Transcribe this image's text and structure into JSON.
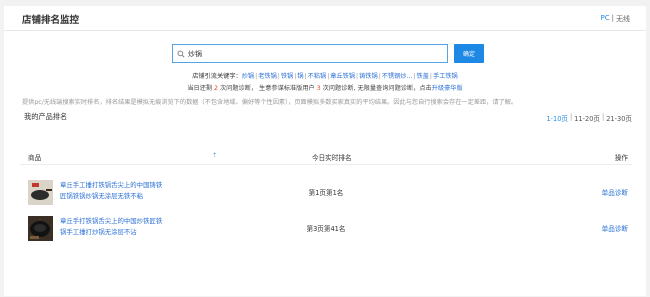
{
  "header": {
    "title": "店铺排名监控",
    "pc_label": "PC",
    "divider": "|",
    "wireless_label": "无线"
  },
  "search": {
    "value": "炒锅",
    "button_label": "确定"
  },
  "related": {
    "prefix": "店铺引流关键字：",
    "keywords": [
      "炒锅",
      "老铁锅",
      "铁锅",
      "锅",
      "不粘锅",
      "章丘铁锅",
      "铸铁锅",
      "不锈钢炒...",
      "铁盖",
      "手工铁锅"
    ]
  },
  "quota": {
    "p1": "当日还剩 ",
    "n1": "2",
    "p2": " 次问题诊断， 生意参谋标准版用户 ",
    "n2": "3",
    "p3": " 次问题诊断, 无限量查询问题诊断，点击",
    "upgrade_link": "升级豪华版"
  },
  "notice": "提供pc/无线端搜索实时排名，排名结果是模拟无痕浏览下的数据（不包含地域、偏好等个性因素），页面模拟多数买家真实的平均结果。因此与您自行搜索会存在一定差距，请了解。",
  "section": {
    "title": "我的产品排名"
  },
  "pager": {
    "p1": "1-10页",
    "p2": "11-20页",
    "p3": "21-30页",
    "sep": "|"
  },
  "table": {
    "col_product": "商品",
    "sort_icon": "⇡",
    "col_rank": "今日实时排名",
    "col_action": "操作",
    "rows": [
      {
        "name": "章丘手工捶打铁锅舌尖上的中国铸铁匠锅铁锅炒锅无涂层无铁不粘",
        "rank": "第1页第1名",
        "action": "单品诊断"
      },
      {
        "name": "章丘手打铁锅舌尖上的中国炒铁匠铁锅手工捶打炒锅无涂层不沾",
        "rank": "第3页第41名",
        "action": "单品诊断"
      }
    ]
  }
}
